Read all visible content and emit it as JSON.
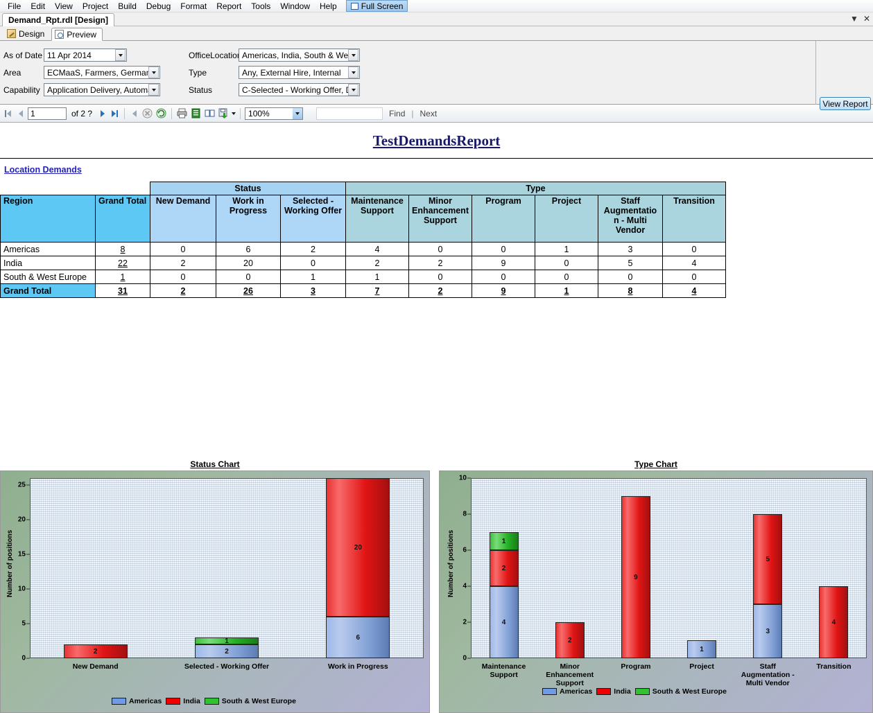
{
  "menu": {
    "items": [
      "File",
      "Edit",
      "View",
      "Project",
      "Build",
      "Debug",
      "Format",
      "Report",
      "Tools",
      "Window",
      "Help"
    ],
    "fullscreen_label": "Full Screen"
  },
  "document_tab": {
    "title": "Demand_Rpt.rdl [Design]"
  },
  "view_tabs": {
    "design": "Design",
    "preview": "Preview"
  },
  "parameters": {
    "as_of_date": {
      "label": "As of Date",
      "value": "11 Apr 2014"
    },
    "area": {
      "label": "Area",
      "value": "ECMaaS, Farmers, Germany, I"
    },
    "capability": {
      "label": "Capability",
      "value": "Application Delivery, Automatic"
    },
    "office_location": {
      "label": "OfficeLocation",
      "value": "Americas, India, South & West"
    },
    "type": {
      "label": "Type",
      "value": "Any, External Hire, Internal"
    },
    "status": {
      "label": "Status",
      "value": "C-Selected - Working Offer, D-"
    },
    "view_report_button": "View Report"
  },
  "report_toolbar": {
    "page_current": "1",
    "page_of": "of  2 ?",
    "zoom": "100%",
    "find_label": "Find",
    "next_label": "Next"
  },
  "report": {
    "title": "TestDemandsReport",
    "section_link": "Location Demands "
  },
  "table": {
    "group_headers": {
      "status": "Status",
      "type": "Type"
    },
    "columns": [
      "Region",
      "Grand Total",
      "New Demand",
      "Work in Progress",
      "Selected - Working Offer",
      "Maintenance Support",
      "Minor Enhancement Support",
      "Program",
      "Project",
      "Staff Augmentatio n - Multi Vendor",
      "Transition"
    ],
    "rows": [
      {
        "region": "Americas",
        "values": [
          "8",
          "0",
          "6",
          "2",
          "4",
          "0",
          "0",
          "1",
          "3",
          "0"
        ]
      },
      {
        "region": "India",
        "values": [
          "22",
          "2",
          "20",
          "0",
          "2",
          "2",
          "9",
          "0",
          "5",
          "4"
        ]
      },
      {
        "region": "South & West Europe",
        "values": [
          "1",
          "0",
          "0",
          "1",
          "1",
          "0",
          "0",
          "0",
          "0",
          "0"
        ]
      },
      {
        "region": "Grand Total",
        "values": [
          "31",
          "2",
          "26",
          "3",
          "7",
          "2",
          "9",
          "1",
          "8",
          "4"
        ]
      }
    ]
  },
  "chart_data": [
    {
      "type": "bar",
      "title": "Status Chart",
      "stacked": true,
      "categories": [
        "New Demand",
        "Selected - Working Offer",
        "Work in Progress"
      ],
      "series": [
        {
          "name": "Americas",
          "color": "#6f9ae8",
          "values": [
            0,
            2,
            6
          ]
        },
        {
          "name": "India",
          "color": "#ee0000",
          "values": [
            2,
            0,
            20
          ]
        },
        {
          "name": "South & West Europe",
          "color": "#2fc42f",
          "values": [
            0,
            1,
            0
          ]
        }
      ],
      "xlabel": "",
      "ylabel": "Number of positions",
      "ylim": [
        0,
        26
      ],
      "yticks": [
        0,
        5,
        10,
        15,
        20,
        25
      ],
      "legend_position": "bottom",
      "grid": false
    },
    {
      "type": "bar",
      "title": "Type Chart",
      "stacked": true,
      "categories": [
        "Maintenance Support",
        "Minor Enhancement Support",
        "Program",
        "Project",
        "Staff Augmentation - Multi Vendor",
        "Transition"
      ],
      "series": [
        {
          "name": "Americas",
          "color": "#6f9ae8",
          "values": [
            4,
            0,
            0,
            1,
            3,
            0
          ]
        },
        {
          "name": "India",
          "color": "#ee0000",
          "values": [
            2,
            2,
            9,
            0,
            5,
            4
          ]
        },
        {
          "name": "South & West Europe",
          "color": "#2fc42f",
          "values": [
            1,
            0,
            0,
            0,
            0,
            0
          ]
        }
      ],
      "xlabel": "",
      "ylabel": "Number of positions",
      "ylim": [
        0,
        10
      ],
      "yticks": [
        0,
        2,
        4,
        6,
        8,
        10
      ],
      "legend_position": "bottom",
      "grid": false
    }
  ]
}
